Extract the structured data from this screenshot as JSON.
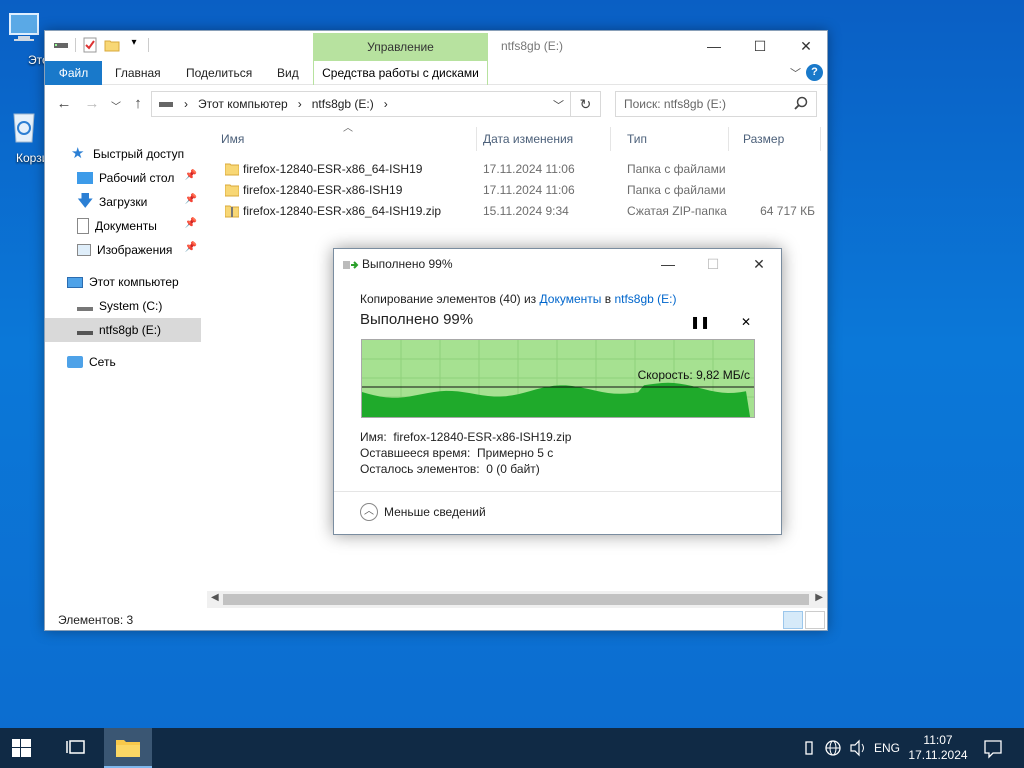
{
  "desktop": {
    "icons": [
      {
        "label": "Этот компьютер"
      },
      {
        "label": "Корзина"
      }
    ]
  },
  "explorer": {
    "title": "ntfs8gb (E:)",
    "manage_tab": "Управление",
    "ribbon_tabs": [
      "Файл",
      "Главная",
      "Поделиться",
      "Вид"
    ],
    "manage_sub": "Средства работы с дисками",
    "breadcrumb": [
      "Этот компьютер",
      "ntfs8gb (E:)"
    ],
    "search_placeholder": "Поиск: ntfs8gb (E:)",
    "nav": {
      "quick_access": "Быстрый доступ",
      "desktop": "Рабочий стол",
      "downloads": "Загрузки",
      "documents": "Документы",
      "images": "Изображения",
      "this_pc": "Этот компьютер",
      "system": "System (C:)",
      "ntfs": "ntfs8gb (E:)",
      "network": "Сеть"
    },
    "columns": [
      "Имя",
      "Дата изменения",
      "Тип",
      "Размер"
    ],
    "files": [
      {
        "name": "firefox-12840-ESR-x86_64-ISH19",
        "date": "17.11.2024 11:06",
        "type": "Папка с файлами",
        "size": ""
      },
      {
        "name": "firefox-12840-ESR-x86-ISH19",
        "date": "17.11.2024 11:06",
        "type": "Папка с файлами",
        "size": ""
      },
      {
        "name": "firefox-12840-ESR-x86_64-ISH19.zip",
        "date": "15.11.2024 9:34",
        "type": "Сжатая ZIP-папка",
        "size": "64 717 КБ"
      }
    ],
    "status": "Элементов: 3"
  },
  "dialog": {
    "title": "Выполнено 99%",
    "copy_prefix": "Копирование элементов (40) из",
    "from": "Документы",
    "in_word": "в",
    "to": "ntfs8gb (E:)",
    "big_percent": "Выполнено 99%",
    "progress": 0.99,
    "speed": "Скорость: 9,82 МБ/с",
    "name_label": "Имя:",
    "name_value": "firefox-12840-ESR-x86-ISH19.zip",
    "time_label": "Оставшееся время:",
    "time_value": "Примерно 5 с",
    "left_label": "Осталось элементов:",
    "left_value": "0 (0 байт)",
    "less_details": "Меньше сведений"
  },
  "taskbar": {
    "lang": "ENG",
    "time": "11:07",
    "date": "17.11.2024"
  },
  "colors": {
    "accent": "#1979ca",
    "manage_green": "#b7e29f",
    "graph_green": "#a6e191",
    "graph_fill": "#1faa2b",
    "taskbar": "#102a45"
  }
}
